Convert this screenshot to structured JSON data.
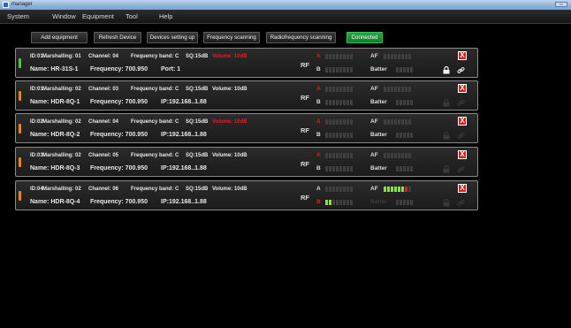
{
  "window": {
    "title": "manager"
  },
  "menu": [
    "System",
    "Window",
    "Equipment",
    "Tool",
    "Help"
  ],
  "toolbar": {
    "add": "Add equipment",
    "refresh": "Refresh Device",
    "setup": "Devices setting up",
    "freq_scan": "Frequency scanning",
    "rf_scan": "Radiofrequency scanning",
    "status": "Connected"
  },
  "labels": {
    "rf": "RF",
    "a": "A",
    "b": "B",
    "af": "AF",
    "battery": "Batter",
    "close": "X"
  },
  "colors": {
    "connected": "#1f9a3e",
    "close": "#d42020",
    "level_green": "#8be04a",
    "level_red": "#e02020",
    "status_green": "#4ec44b",
    "status_orange": "#e08a10"
  },
  "devices": [
    {
      "id": "ID:01",
      "marshalling": "Marshalling: 01",
      "channel": "Channel: 04",
      "band": "Frequency band: C",
      "sq": "SQ:15dB",
      "volume": "Volume: 10dB",
      "volume_muted": true,
      "name": "Name: HR-31S-1",
      "frequency": "Frequency: 700.950",
      "extra": "Port: 1",
      "status_color": "#4ec44b",
      "a_active": false,
      "b_active": true,
      "af_level": 0,
      "b_level": 0,
      "battery_visible": true,
      "locked": true
    },
    {
      "id": "ID:01",
      "marshalling": "Marshalling: 02",
      "channel": "Channel: 03",
      "band": "Frequency band: C",
      "sq": "SQ:15dB",
      "volume": "Volume: 10dB",
      "volume_muted": false,
      "name": "Name: HDR-8Q-1",
      "frequency": "Frequency: 700.950",
      "extra": "IP:192.168..1.88",
      "status_color": "#e08a10",
      "a_active": false,
      "b_active": true,
      "af_level": 0,
      "b_level": 0,
      "battery_visible": true,
      "locked": false
    },
    {
      "id": "ID:02",
      "marshalling": "Marshalling: 02",
      "channel": "Channel: 04",
      "band": "Frequency band: C",
      "sq": "SQ:15dB",
      "volume": "Volume: 10dB",
      "volume_muted": true,
      "name": "Name: HDR-8Q-2",
      "frequency": "Frequency: 700.950",
      "extra": "IP:192.168..1.88",
      "status_color": "#e08a10",
      "a_active": false,
      "b_active": true,
      "af_level": 0,
      "b_level": 0,
      "battery_visible": true,
      "locked": false
    },
    {
      "id": "ID:03",
      "marshalling": "Marshalling: 02",
      "channel": "Channel: 05",
      "band": "Frequency band: C",
      "sq": "SQ:15dB",
      "volume": "Volume: 10dB",
      "volume_muted": false,
      "name": "Name: HDR-8Q-3",
      "frequency": "Frequency: 700.950",
      "extra": "IP:192.168..1.88",
      "status_color": "#e08a10",
      "a_active": false,
      "b_active": true,
      "af_level": 0,
      "b_level": 0,
      "battery_visible": true,
      "locked": false
    },
    {
      "id": "ID:04",
      "marshalling": "Marshalling: 02",
      "channel": "Channel: 06",
      "band": "Frequency band: C",
      "sq": "SQ:15dB",
      "volume": "Volume: 10dB",
      "volume_muted": false,
      "name": "Name: HDR-8Q-4",
      "frequency": "Frequency: 700.950",
      "extra": "IP:192.168..1.88",
      "status_color": "#e08a10",
      "a_active": true,
      "b_active": false,
      "af_level": 0.875,
      "b_level": 0.25,
      "battery_visible": false,
      "locked": false
    }
  ]
}
